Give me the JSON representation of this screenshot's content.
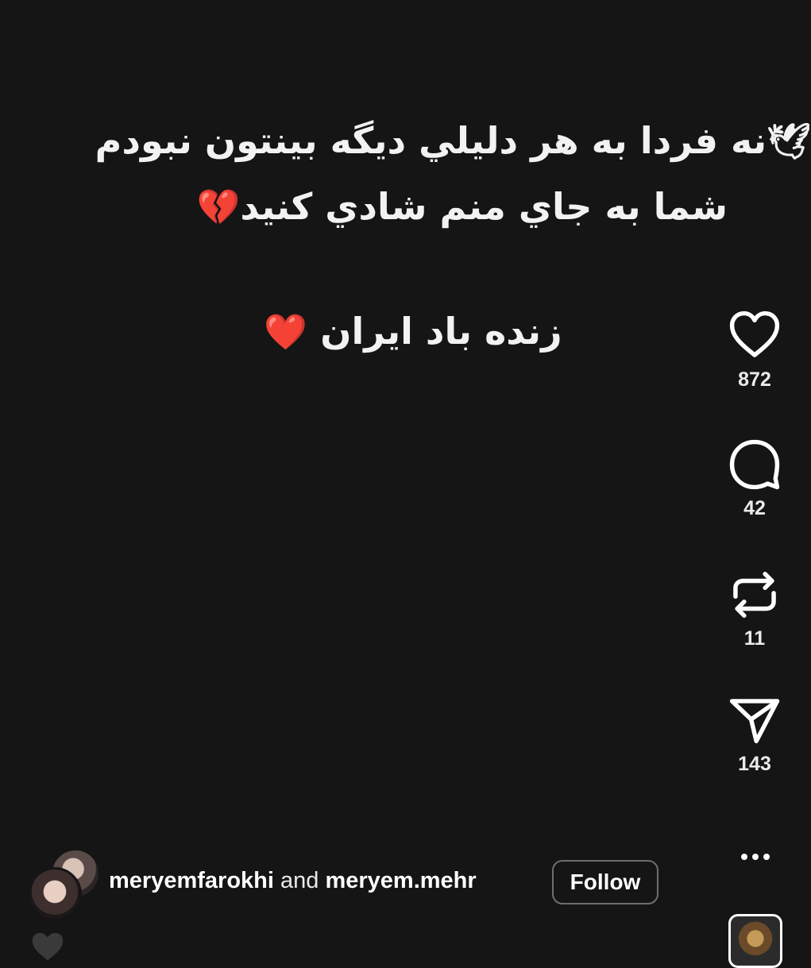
{
  "post": {
    "caption_line1": "نه فردا به هر دليلي ديگه بينتون نبودم",
    "caption_line1_emoji": "🕊",
    "caption_line2": "شما به جاي منم شادي كنيد",
    "caption_line2_emoji": "💔",
    "caption_line3": "زنده باد ايران",
    "caption_line3_emoji": "❤️"
  },
  "actions": {
    "likes": "872",
    "comments": "42",
    "reposts": "11",
    "shares": "143",
    "icons": [
      "heart-icon",
      "comment-icon",
      "repost-icon",
      "share-icon",
      "more-icon"
    ]
  },
  "author": {
    "username_primary": "meryemfarokhi",
    "joiner": "and",
    "username_secondary": "meryem.mehr",
    "follow_label": "Follow"
  },
  "colors": {
    "background": "#161515",
    "heart_red": "#e0242c",
    "text": "#ffffff"
  }
}
